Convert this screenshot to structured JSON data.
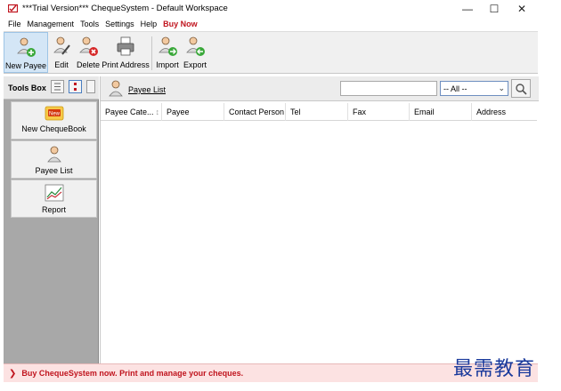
{
  "window": {
    "title": "***Trial Version*** ChequeSystem - Default Workspace",
    "icon": "cheque-app-icon",
    "minimize_glyph": "—",
    "maximize_glyph": "☐",
    "close_glyph": "✕"
  },
  "menu": {
    "items": [
      "File",
      "Management",
      "Tools",
      "Settings",
      "Help"
    ],
    "buy_now": "Buy Now",
    "buy_now_color": "#c0141e"
  },
  "toolbar": {
    "buttons": [
      {
        "label": "New Payee",
        "icon": "add-person-icon"
      },
      {
        "label": "Edit",
        "icon": "edit-person-icon"
      },
      {
        "label": "Delete",
        "icon": "delete-person-icon"
      },
      {
        "label": "Print Address",
        "icon": "printer-icon"
      },
      {
        "label": "Import",
        "icon": "import-person-icon"
      },
      {
        "label": "Export",
        "icon": "export-person-icon"
      }
    ]
  },
  "tools_box": {
    "title": "Tools Box",
    "items": [
      {
        "label": "New ChequeBook",
        "icon": "new-chequebook-icon"
      },
      {
        "label": "Payee List",
        "icon": "payee-icon"
      },
      {
        "label": "Report",
        "icon": "report-chart-icon"
      }
    ]
  },
  "payee_list": {
    "title": "Payee List",
    "search_value": "",
    "filter_selected": "-- All --",
    "columns": [
      "Payee Cate...",
      "Payee",
      "Contact Person",
      "Tel",
      "Fax",
      "Email",
      "Address"
    ],
    "rows": []
  },
  "status_bar": {
    "message": "Buy ChequeSystem now. Print and manage your cheques.",
    "color": "#c0141e"
  },
  "watermark": {
    "text": "最需教育"
  },
  "colors": {
    "accent_red": "#c0141e",
    "panel_gray": "#a8a8a8",
    "watermark_blue": "#1a3a9c"
  }
}
